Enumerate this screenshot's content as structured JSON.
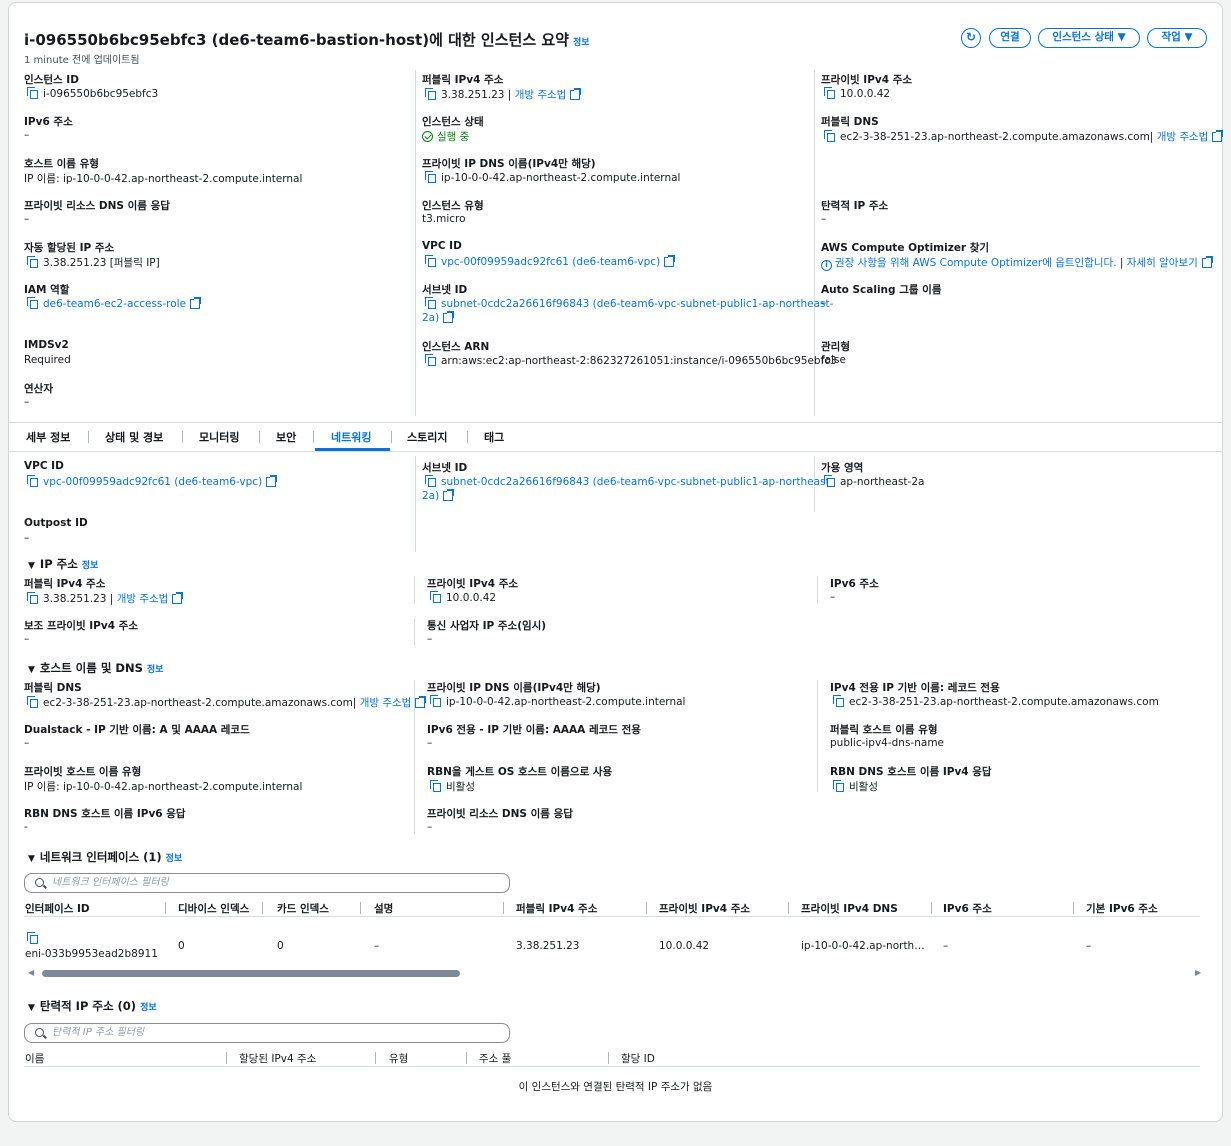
{
  "header": {
    "title": "i-096550b6bc95ebfc3 (de6-team6-bastion-host)에 대한 인스턴스 요약",
    "info": "정보",
    "updated": "1 minute 전에 업데이트됨",
    "buttons": {
      "connect": "연결",
      "instance_state": "인스턴스 상태",
      "actions": "작업"
    }
  },
  "summary": {
    "instance_id": {
      "label": "인스턴스 ID",
      "value": "i-096550b6bc95ebfc3"
    },
    "public_ipv4": {
      "label": "퍼블릭 IPv4 주소",
      "value": "3.38.251.23",
      "link": "개방 주소법"
    },
    "private_ipv4": {
      "label": "프라이빗 IPv4 주소",
      "value": "10.0.0.42"
    },
    "ipv6": {
      "label": "IPv6 주소",
      "value": "–"
    },
    "instance_state": {
      "label": "인스턴스 상태",
      "value": "실행 중"
    },
    "public_dns": {
      "label": "퍼블릭 DNS",
      "value": "ec2-3-38-251-23.ap-northeast-2.compute.amazonaws.com",
      "link": "개방 주소법"
    },
    "hostname_type": {
      "label": "호스트 이름 유형",
      "value": "IP 이름: ip-10-0-0-42.ap-northeast-2.compute.internal"
    },
    "private_ip_dns": {
      "label": "프라이빗 IP DNS 이름(IPv4만 해당)",
      "value": "ip-10-0-0-42.ap-northeast-2.compute.internal"
    },
    "private_resource_dns": {
      "label": "프라이빗 리소스 DNS 이름 응답",
      "value": "–"
    },
    "instance_type": {
      "label": "인스턴스 유형",
      "value": "t3.micro"
    },
    "elastic_ip": {
      "label": "탄력적 IP 주소",
      "value": "–"
    },
    "auto_assigned_ip": {
      "label": "자동 할당된 IP 주소",
      "value": "3.38.251.23 [퍼블릭 IP]"
    },
    "vpc_id": {
      "label": "VPC ID",
      "value": "vpc-00f09959adc92fc61 (de6-team6-vpc)"
    },
    "compute_optimizer": {
      "label": "AWS Compute Optimizer 찾기",
      "value": "권장 사항을 위해 AWS Compute Optimizer에 옵트인합니다.",
      "link": "자세히 알아보기"
    },
    "iam_role": {
      "label": "IAM 역할",
      "value": "de6-team6-ec2-access-role"
    },
    "subnet_id": {
      "label": "서브넷 ID",
      "value_line1": "subnet-0cdc2a26616f96843 (de6-team6-vpc-subnet-public1-ap-northeast-",
      "value_line2": "2a)"
    },
    "auto_scaling": {
      "label": "Auto Scaling 그룹 이름",
      "value": "–"
    },
    "imdsv2": {
      "label": "IMDSv2",
      "value": "Required"
    },
    "instance_arn": {
      "label": "인스턴스 ARN",
      "value": "arn:aws:ec2:ap-northeast-2:862327261051:instance/i-096550b6bc95ebfc3"
    },
    "managed": {
      "label": "관리형",
      "value": "false"
    },
    "operator": {
      "label": "연산자",
      "value": "–"
    }
  },
  "tabs": [
    "세부 정보",
    "상태 및 경보",
    "모니터링",
    "보안",
    "네트워킹",
    "스토리지",
    "태그"
  ],
  "networking": {
    "vpc_id": {
      "label": "VPC ID",
      "value": "vpc-00f09959adc92fc61 (de6-team6-vpc)"
    },
    "subnet_id": {
      "label": "서브넷 ID",
      "value_line1": "subnet-0cdc2a26616f96843 (de6-team6-vpc-subnet-public1-ap-northeast-",
      "value_line2": "2a)"
    },
    "az": {
      "label": "가용 영역",
      "value": "ap-northeast-2a"
    },
    "outpost": {
      "label": "Outpost ID",
      "value": "–"
    },
    "ip_section": {
      "title": "IP 주소",
      "info": "정보",
      "public_ipv4": {
        "label": "퍼블릭 IPv4 주소",
        "value": "3.38.251.23",
        "link": "개방 주소법"
      },
      "private_ipv4": {
        "label": "프라이빗 IPv4 주소",
        "value": "10.0.0.42"
      },
      "ipv6": {
        "label": "IPv6 주소",
        "value": "–"
      },
      "secondary": {
        "label": "보조 프라이빗 IPv4 주소",
        "value": "–"
      },
      "carrier": {
        "label": "통신 사업자 IP 주소(임시)",
        "value": "–"
      }
    },
    "dns_section": {
      "title": "호스트 이름 및 DNS",
      "info": "정보",
      "public_dns": {
        "label": "퍼블릭 DNS",
        "value": "ec2-3-38-251-23.ap-northeast-2.compute.amazonaws.com",
        "link": "개방 주소법"
      },
      "private_ip_dns": {
        "label": "프라이빗 IP DNS 이름(IPv4만 해당)",
        "value": "ip-10-0-0-42.ap-northeast-2.compute.internal"
      },
      "ipv4_ip_name": {
        "label": "IPv4 전용 IP 기반 이름: 레코드 전용",
        "value": "ec2-3-38-251-23.ap-northeast-2.compute.amazonaws.com"
      },
      "dualstack": {
        "label": "Dualstack - IP 기반 이름: A 및 AAAA 레코드",
        "value": "–"
      },
      "ipv6_only": {
        "label": "IPv6 전용 - IP 기반 이름: AAAA 레코드 전용",
        "value": "–"
      },
      "public_hostname_type": {
        "label": "퍼블릭 호스트 이름 유형",
        "value": "public-ipv4-dns-name"
      },
      "private_hostname_type": {
        "label": "프라이빗 호스트 이름 유형",
        "value": "IP 이름: ip-10-0-0-42.ap-northeast-2.compute.internal"
      },
      "rbn_guest": {
        "label": "RBN을 게스트 OS 호스트 이름으로 사용",
        "value": "비활성"
      },
      "rbn_ipv4": {
        "label": "RBN DNS 호스트 이름 IPv4 응답",
        "value": "비활성"
      },
      "rbn_ipv6": {
        "label": "RBN DNS 호스트 이름 IPv6 응답",
        "value": "-"
      },
      "private_resource_dns": {
        "label": "프라이빗 리소스 DNS 이름 응답",
        "value": "–"
      }
    },
    "eni_section": {
      "title": "네트워크 인터페이스 (1)",
      "info": "정보",
      "filter_placeholder": "네트워크 인터페이스 필터링",
      "columns": [
        "인터페이스 ID",
        "디바이스 인덱스",
        "카드 인덱스",
        "설명",
        "퍼블릭 IPv4 주소",
        "프라이빗 IPv4 주소",
        "프라이빗 IPv4 DNS",
        "IPv6 주소",
        "기본 IPv6 주소"
      ],
      "row": [
        "eni-033b9953ead2b8911",
        "0",
        "0",
        "–",
        "3.38.251.23",
        "10.0.0.42",
        "ip-10-0-0-42.ap-north…",
        "–",
        "–"
      ]
    },
    "eip_section": {
      "title": "탄력적 IP 주소 (0)",
      "info": "정보",
      "filter_placeholder": "탄력적 IP 주소 필터링",
      "columns": [
        "이름",
        "할당된 IPv4 주소",
        "유형",
        "주소 풀",
        "할당 ID"
      ],
      "empty": "이 인스턴스와 연결된 탄력적 IP 주소가 없음"
    }
  }
}
